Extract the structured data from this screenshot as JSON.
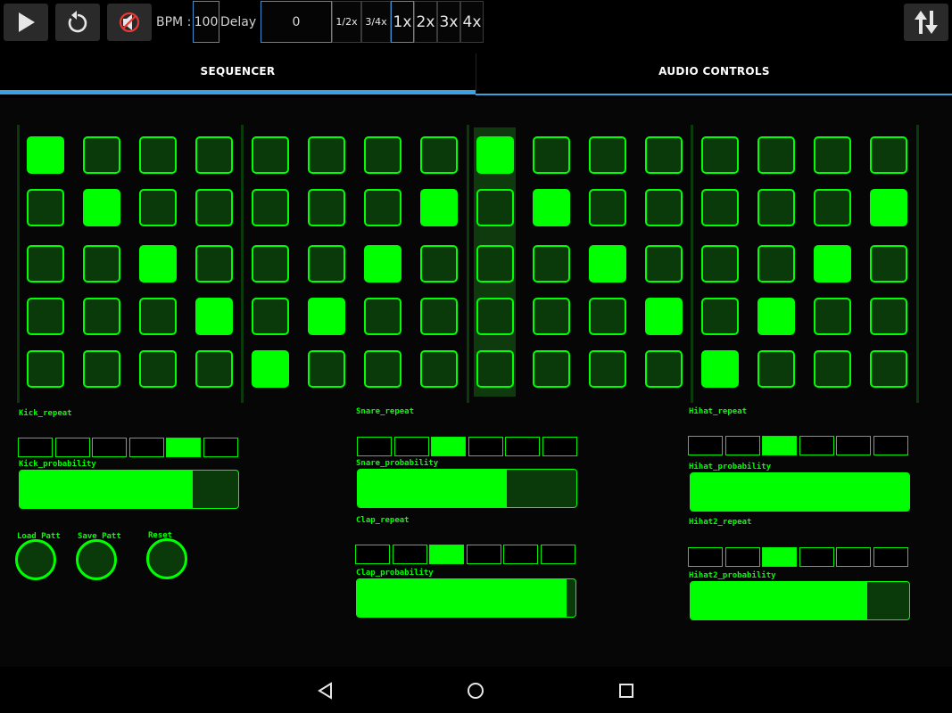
{
  "toolbar": {
    "bpm_label": "BPM :",
    "bpm_value": "100",
    "delay_label": "Delay :",
    "delay_value": "0",
    "multipliers": [
      "1/2x",
      "3/4x",
      "1x",
      "2x",
      "3x",
      "4x"
    ],
    "selected_multiplier": "1x",
    "icons": [
      "play-icon",
      "replay-icon",
      "speaker-muted-icon",
      "swap-vertical-icon"
    ]
  },
  "tabs": {
    "sequencer": "SEQUENCER",
    "audio_controls": "AUDIO CONTROLS",
    "active": "SEQUENCER"
  },
  "sequencer": {
    "rows": 5,
    "steps": 16,
    "current_step": 9,
    "active": [
      [
        1,
        0,
        0,
        0,
        0,
        0,
        0,
        0,
        1,
        0,
        0,
        0,
        0,
        0,
        0,
        0
      ],
      [
        0,
        1,
        0,
        0,
        0,
        0,
        0,
        1,
        0,
        1,
        0,
        0,
        0,
        0,
        0,
        1
      ],
      [
        0,
        0,
        1,
        0,
        0,
        0,
        1,
        0,
        0,
        0,
        1,
        0,
        0,
        0,
        1,
        0
      ],
      [
        0,
        0,
        0,
        1,
        0,
        1,
        0,
        0,
        0,
        0,
        0,
        1,
        0,
        1,
        0,
        0
      ],
      [
        0,
        0,
        0,
        0,
        1,
        0,
        0,
        0,
        0,
        0,
        0,
        0,
        1,
        0,
        0,
        0
      ]
    ]
  },
  "controls": {
    "kick_repeat_label": "Kick_repeat",
    "kick_repeat_selected": 5,
    "kick_probability_label": "Kick_probability",
    "kick_probability": 0.79,
    "snare_repeat_label": "Snare_repeat",
    "snare_repeat_selected": 3,
    "snare_probability_label": "Snare_probability",
    "snare_probability": 0.68,
    "clap_repeat_label": "Clap_repeat",
    "clap_repeat_selected": 3,
    "clap_probability_label": "Clap_probability",
    "clap_probability": 0.96,
    "hihat_repeat_label": "Hihat_repeat",
    "hihat_repeat_selected": 3,
    "hihat_probability_label": "Hihat_probability",
    "hihat_probability": 1.0,
    "hihat2_repeat_label": "Hihat2_repeat",
    "hihat2_repeat_selected": 3,
    "hihat2_probability_label": "Hihat2_probability",
    "hihat2_probability": 0.81,
    "repeat_segments": 6
  },
  "buttons": {
    "load_patt": "Load Patt",
    "save_patt": "Save Patt",
    "reset": "Reset"
  },
  "colors": {
    "accent_green": "#00ff00",
    "pad_off": "#0a3a0a",
    "tab_indicator": "#3aa3e3"
  },
  "navbar": {
    "icons": [
      "back-icon",
      "home-icon",
      "recents-icon"
    ]
  }
}
